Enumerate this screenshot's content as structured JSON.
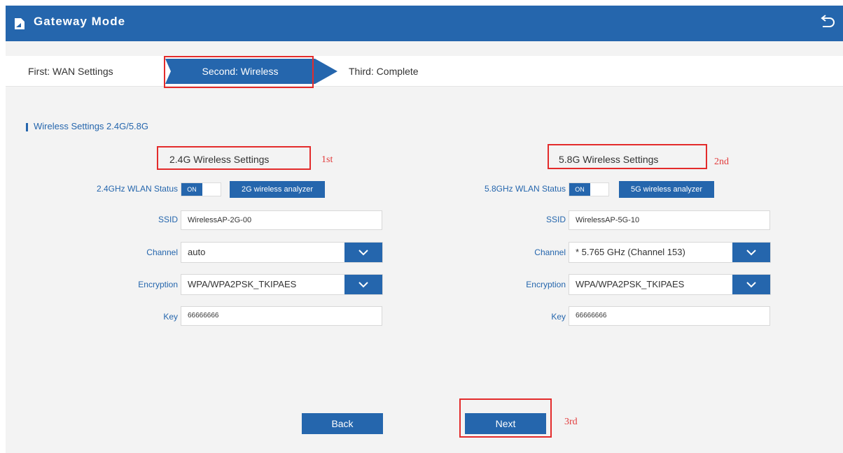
{
  "header": {
    "title": "Gateway Mode"
  },
  "steps": [
    "First: WAN Settings",
    "Second: Wireless",
    "Third: Complete"
  ],
  "section": {
    "title": "Wireless Settings 2.4G/5.8G"
  },
  "band_24": {
    "title": "2.4G Wireless Settings",
    "annotation": "1st",
    "status_label": "2.4GHz WLAN Status",
    "toggle": "ON",
    "analyzer": "2G wireless analyzer",
    "ssid_label": "SSID",
    "ssid": "WirelessAP-2G-00",
    "channel_label": "Channel",
    "channel": "auto",
    "encryption_label": "Encryption",
    "encryption": "WPA/WPA2PSK_TKIPAES",
    "key_label": "Key",
    "key": "66666666"
  },
  "band_58": {
    "title": "5.8G Wireless Settings",
    "annotation": "2nd",
    "status_label": "5.8GHz WLAN Status",
    "toggle": "ON",
    "analyzer": "5G wireless analyzer",
    "ssid_label": "SSID",
    "ssid": "WirelessAP-5G-10",
    "channel_label": "Channel",
    "channel": "* 5.765 GHz (Channel 153)",
    "encryption_label": "Encryption",
    "encryption": "WPA/WPA2PSK_TKIPAES",
    "key_label": "Key",
    "key": "66666666"
  },
  "buttons": {
    "back": "Back",
    "next": "Next",
    "next_annotation": "3rd"
  },
  "colors": {
    "primary": "#2566ad",
    "annotation": "#e32b2b",
    "background": "#f3f3f3"
  }
}
